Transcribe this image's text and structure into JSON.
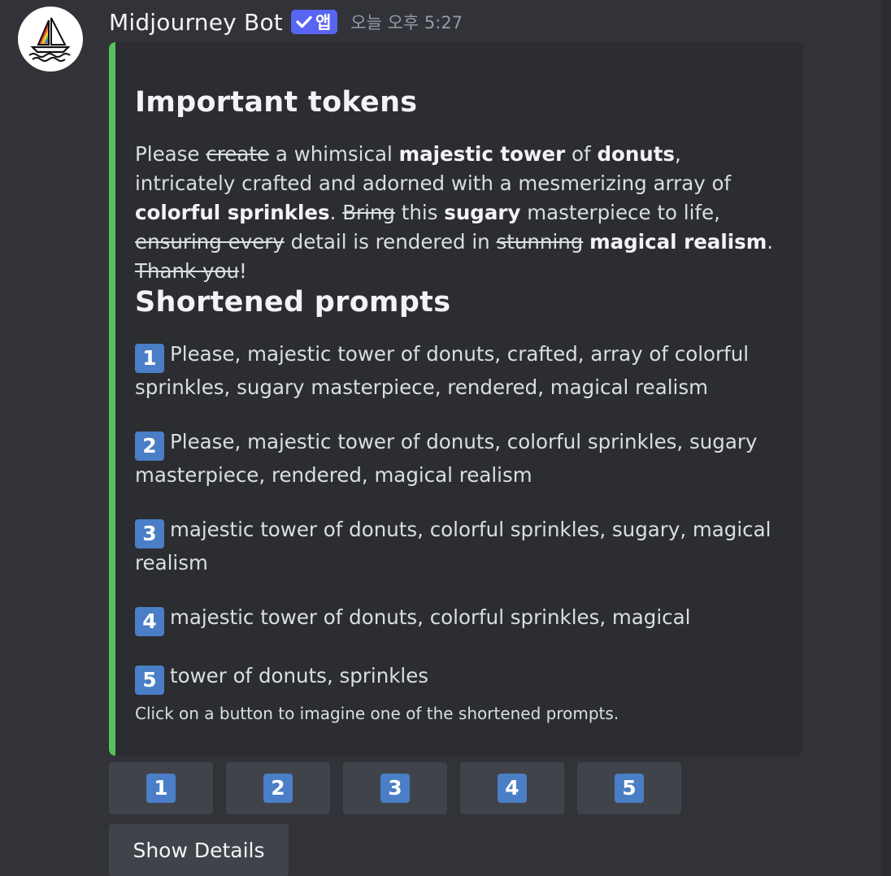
{
  "message": {
    "author": "Midjourney Bot",
    "badge": "앱",
    "timestamp": "오늘 오후 5:27"
  },
  "embed": {
    "accent_color": "#57c25c",
    "important_title": "Important tokens",
    "paragraph": [
      {
        "text": "Please ",
        "style": "normal"
      },
      {
        "text": "create",
        "style": "strike"
      },
      {
        "text": " a whimsical ",
        "style": "normal"
      },
      {
        "text": "majestic tower",
        "style": "bold"
      },
      {
        "text": " of ",
        "style": "normal"
      },
      {
        "text": "donuts",
        "style": "bold"
      },
      {
        "text": ", intricately crafted and adorned with a mesmerizing array of ",
        "style": "normal"
      },
      {
        "text": "colorful sprinkles",
        "style": "bold"
      },
      {
        "text": ". ",
        "style": "normal"
      },
      {
        "text": "Bring",
        "style": "strike"
      },
      {
        "text": " this ",
        "style": "normal"
      },
      {
        "text": "sugary",
        "style": "bold"
      },
      {
        "text": " masterpiece to life, ",
        "style": "normal"
      },
      {
        "text": "ensuring every",
        "style": "strike"
      },
      {
        "text": " detail is rendered in ",
        "style": "normal"
      },
      {
        "text": "stunning",
        "style": "strike"
      },
      {
        "text": " ",
        "style": "normal"
      },
      {
        "text": "magical realism",
        "style": "bold"
      },
      {
        "text": ". ",
        "style": "normal"
      },
      {
        "text": "Thank you",
        "style": "strike"
      },
      {
        "text": "!",
        "style": "normal"
      }
    ],
    "shortened_title": "Shortened prompts",
    "prompts": [
      {
        "num": "1",
        "text": "Please, majestic tower of donuts, crafted, array of colorful sprinkles, sugary masterpiece, rendered, magical realism"
      },
      {
        "num": "2",
        "text": "Please, majestic tower of donuts, colorful sprinkles, sugary masterpiece, rendered, magical realism"
      },
      {
        "num": "3",
        "text": "majestic tower of donuts, colorful sprinkles, sugary, magical realism"
      },
      {
        "num": "4",
        "text": "majestic tower of donuts, colorful sprinkles, magical"
      },
      {
        "num": "5",
        "text": "tower of donuts, sprinkles"
      }
    ],
    "footer": "Click on a button to imagine one of the shortened prompts."
  },
  "buttons": [
    "1",
    "2",
    "3",
    "4",
    "5"
  ],
  "show_details_label": "Show Details",
  "colors": {
    "background": "#313338",
    "embed_background": "#2b2d31",
    "button_background": "#41434a",
    "keycap": "#4a7ec6",
    "badge": "#5865f2"
  },
  "icons": {
    "avatar": "midjourney-sailboat-logo",
    "badge": "checkmark-icon",
    "keycap": "keycap-digit-icon"
  }
}
